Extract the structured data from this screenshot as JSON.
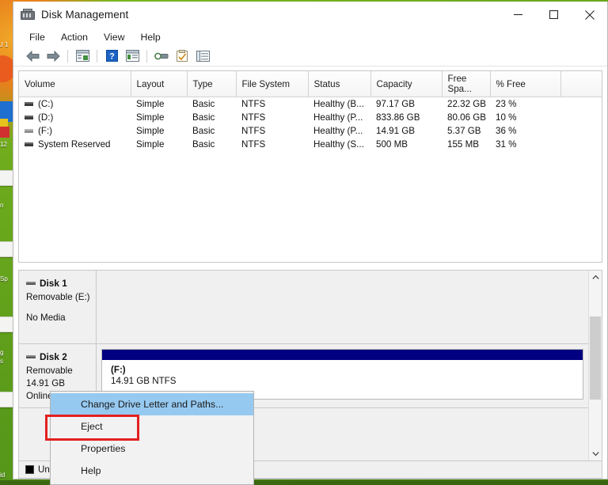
{
  "desktop": {
    "icon_labels": [
      "U 1",
      "12",
      "n",
      "Sp",
      "g",
      "s",
      "id"
    ]
  },
  "window": {
    "title": "Disk Management",
    "app_icon": "disk-management-icon",
    "controls": [
      {
        "name": "minimize-button",
        "glyph": "minimize"
      },
      {
        "name": "maximize-button",
        "glyph": "maximize"
      },
      {
        "name": "close-button",
        "glyph": "close"
      }
    ]
  },
  "menubar": {
    "items": [
      {
        "name": "menu-file",
        "label": "File"
      },
      {
        "name": "menu-action",
        "label": "Action"
      },
      {
        "name": "menu-view",
        "label": "View"
      },
      {
        "name": "menu-help",
        "label": "Help"
      }
    ]
  },
  "toolbar": {
    "buttons": [
      {
        "name": "back-icon",
        "title": "Back"
      },
      {
        "name": "forward-icon",
        "title": "Forward"
      },
      {
        "name": "show-hide-console-tree-icon",
        "title": "Show/Hide Console Tree"
      },
      {
        "name": "help-icon",
        "title": "Help"
      },
      {
        "name": "show-hide-action-pane-icon",
        "title": "Show/Hide Action Pane"
      },
      {
        "name": "rescan-disks-icon",
        "title": "Rescan Disks"
      },
      {
        "name": "properties-icon",
        "title": "Properties"
      },
      {
        "name": "list-view-icon",
        "title": "List View"
      }
    ]
  },
  "volume_table": {
    "columns": [
      "Volume",
      "Layout",
      "Type",
      "File System",
      "Status",
      "Capacity",
      "Free Spa...",
      "% Free",
      ""
    ],
    "rows": [
      {
        "volume": "(C:)",
        "layout": "Simple",
        "type": "Basic",
        "file_system": "NTFS",
        "status": "Healthy (B...",
        "capacity": "97.17 GB",
        "free_space": "22.32 GB",
        "percent_free": "23 %"
      },
      {
        "volume": "(D:)",
        "layout": "Simple",
        "type": "Basic",
        "file_system": "NTFS",
        "status": "Healthy (P...",
        "capacity": "833.86 GB",
        "free_space": "80.06 GB",
        "percent_free": "10 %"
      },
      {
        "volume": "(F:)",
        "layout": "Simple",
        "type": "Basic",
        "file_system": "NTFS",
        "status": "Healthy (P...",
        "capacity": "14.91 GB",
        "free_space": "5.37 GB",
        "percent_free": "36 %"
      },
      {
        "volume": "System Reserved",
        "layout": "Simple",
        "type": "Basic",
        "file_system": "NTFS",
        "status": "Healthy (S...",
        "capacity": "500 MB",
        "free_space": "155 MB",
        "percent_free": "31 %"
      }
    ]
  },
  "disk_pane": {
    "disks": [
      {
        "title": "Disk 1",
        "line1": "Removable (E:)",
        "line2": "",
        "line3": "No Media",
        "has_partition": false,
        "partition": {
          "name": "",
          "size": ""
        }
      },
      {
        "title": "Disk 2",
        "line1": "Removable",
        "line2": "14.91 GB",
        "line3": "Online",
        "has_partition": true,
        "partition": {
          "name": "(F:)",
          "size": "14.91 GB NTFS"
        }
      }
    ],
    "legend": {
      "label": "Unall",
      "color": "#000000"
    },
    "scrollbar": {
      "up_arrow": "chevron-up-icon",
      "down_arrow": "chevron-down-icon"
    }
  },
  "context_menu": {
    "items": [
      {
        "name": "ctx-change-drive-letter",
        "label": "Change Drive Letter and Paths...",
        "selected": true
      },
      {
        "name": "ctx-eject",
        "label": "Eject",
        "selected": false
      },
      {
        "name": "ctx-properties",
        "label": "Properties",
        "selected": false
      },
      {
        "name": "ctx-help",
        "label": "Help",
        "selected": false
      }
    ],
    "highlight_color": "#96c9f0",
    "annotation_color": "#e2201f"
  }
}
